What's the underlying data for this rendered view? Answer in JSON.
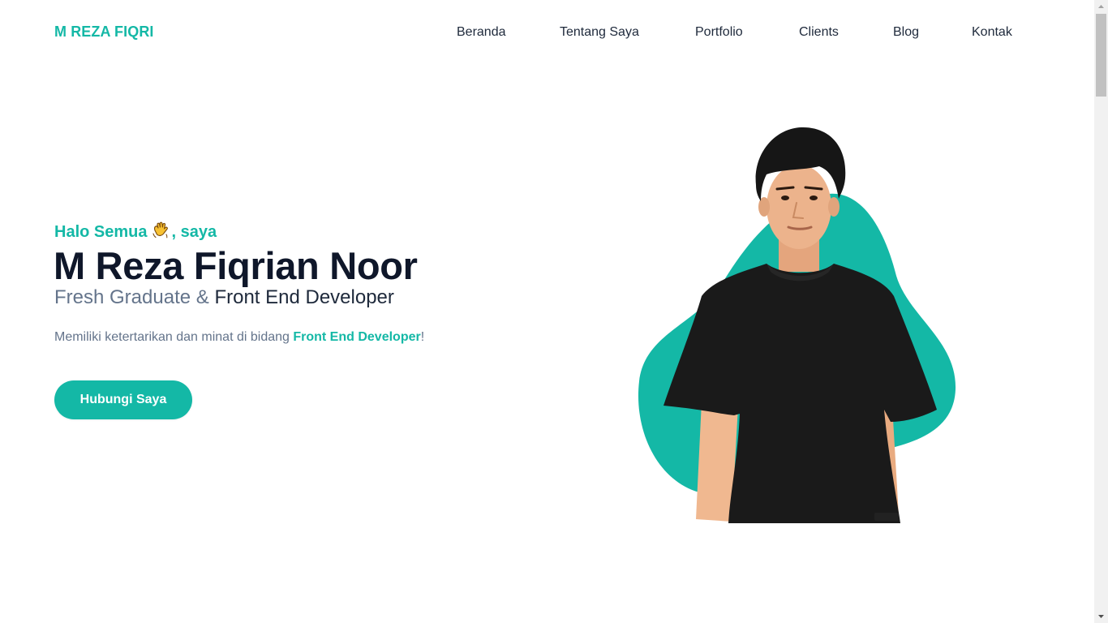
{
  "header": {
    "logo": "M REZA FIQRI",
    "nav": [
      {
        "label": "Beranda"
      },
      {
        "label": "Tentang Saya"
      },
      {
        "label": "Portfolio"
      },
      {
        "label": "Clients"
      },
      {
        "label": "Blog"
      },
      {
        "label": "Kontak"
      }
    ]
  },
  "hero": {
    "greeting_before": "Halo Semua",
    "greeting_icon": "waving-hand-icon",
    "greeting_after": ", saya",
    "name": "M Reza Fiqrian Noor",
    "role_part1": "Fresh Graduate & ",
    "role_part2": "Front End Developer",
    "description_before": "Memiliki ketertarikan dan minat di bidang ",
    "description_highlight": "Front End Developer",
    "description_after": "!",
    "cta_label": "Hubungi Saya",
    "photo_icon": "profile-photo"
  },
  "colors": {
    "accent": "#14b8a6",
    "heading": "#0f172a",
    "muted": "#64748b",
    "nav_text": "#1e293b"
  }
}
